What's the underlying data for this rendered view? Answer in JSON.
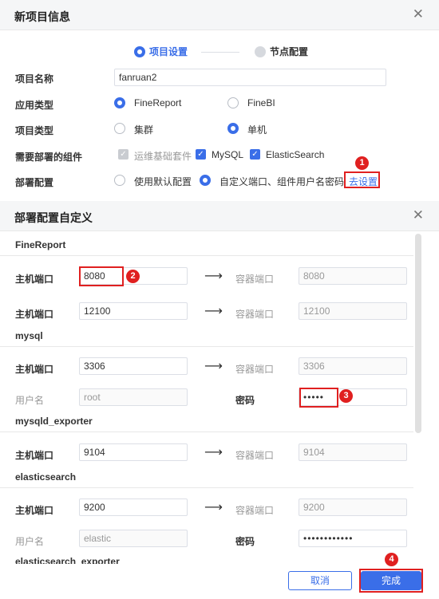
{
  "dialog1": {
    "title": "新项目信息"
  },
  "steps": [
    {
      "label": "项目设置"
    },
    {
      "label": "节点配置"
    }
  ],
  "form": {
    "project_name_label": "项目名称",
    "project_name_value": "fanruan2",
    "app_type_label": "应用类型",
    "app_type_options": [
      "FineReport",
      "FineBI"
    ],
    "project_type_label": "项目类型",
    "project_type_options": [
      "集群",
      "单机"
    ],
    "components_label": "需要部署的组件",
    "components": [
      "运维基础套件",
      "MySQL",
      "ElasticSearch"
    ],
    "deploy_label": "部署配置",
    "deploy_options": [
      "使用默认配置",
      "自定义端口、组件用户名密码"
    ],
    "goto_settings": "去设置"
  },
  "dialog2": {
    "title": "部署配置自定义"
  },
  "labels": {
    "host_port": "主机端口",
    "container_port": "容器端口",
    "username": "用户名",
    "password": "密码"
  },
  "sections": {
    "finereport": {
      "title": "FineReport",
      "row1_host": "8080",
      "row1_container": "8080",
      "row2_host": "12100",
      "row2_container": "12100"
    },
    "mysql": {
      "title": "mysql",
      "host": "3306",
      "container": "3306",
      "username": "root",
      "password": "•••••"
    },
    "mysqld_exporter": {
      "title": "mysqld_exporter",
      "host": "9104",
      "container": "9104"
    },
    "elasticsearch": {
      "title": "elasticsearch",
      "host": "9200",
      "container": "9200",
      "username": "elastic",
      "password": "••••••••••••"
    },
    "elasticsearch_exporter": {
      "title": "elasticsearch_exporter"
    }
  },
  "footer": {
    "cancel": "取消",
    "finish": "完成"
  },
  "annotations": [
    "1",
    "2",
    "3",
    "4"
  ],
  "colors": {
    "accent": "#3a6ee8",
    "annotation": "#e02020"
  }
}
